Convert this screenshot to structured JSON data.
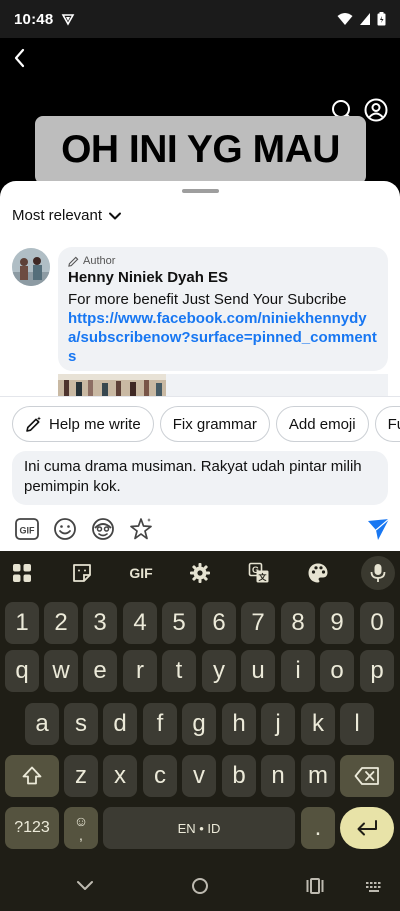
{
  "status_bar": {
    "time": "10:48",
    "icons": [
      "vpn-icon",
      "wifi-icon",
      "signal-icon",
      "battery-icon"
    ]
  },
  "video": {
    "caption": "OH INI YG MAU",
    "icons": [
      "back-icon",
      "search-icon",
      "profile-icon"
    ]
  },
  "comments": {
    "sort_label": "Most relevant",
    "pinned": {
      "badge": "Author",
      "author": "Henny Niniek Dyah ES",
      "text": "For more benefit Just Send Your Subcribe",
      "link": "https://www.facebook.com/niniekhennydya/subscribenow?surface=pinned_comments"
    }
  },
  "ai_chips": [
    "Help me write",
    "Fix grammar",
    "Add emoji",
    "Fu"
  ],
  "input": {
    "value": "Ini cuma drama musiman. Rakyat udah pintar milih pemimpin kok."
  },
  "composer_tools": [
    "gif-icon",
    "emoji-icon",
    "avatar-sticker-icon",
    "sparkle-sticker-icon",
    "send-icon"
  ],
  "keyboard": {
    "toolbar": {
      "gif_label": "GIF",
      "icons": [
        "apps-grid-icon",
        "sticker-icon",
        "settings-icon",
        "translate-icon",
        "palette-icon",
        "mic-icon"
      ]
    },
    "row_numbers": [
      "1",
      "2",
      "3",
      "4",
      "5",
      "6",
      "7",
      "8",
      "9",
      "0"
    ],
    "row1": [
      "q",
      "w",
      "e",
      "r",
      "t",
      "y",
      "u",
      "i",
      "o",
      "p"
    ],
    "row2": [
      "a",
      "s",
      "d",
      "f",
      "g",
      "h",
      "j",
      "k",
      "l"
    ],
    "row3": [
      "z",
      "x",
      "c",
      "v",
      "b",
      "n",
      "m"
    ],
    "symbols_key": "?123",
    "emoji_key_top": "☺",
    "emoji_key_bottom": ",",
    "space_label": "EN • ID",
    "period_key": "."
  },
  "nav_bar": {
    "icons": [
      "nav-back-icon",
      "nav-home-icon",
      "nav-recents-icon",
      "keyboard-switch-icon"
    ]
  }
}
